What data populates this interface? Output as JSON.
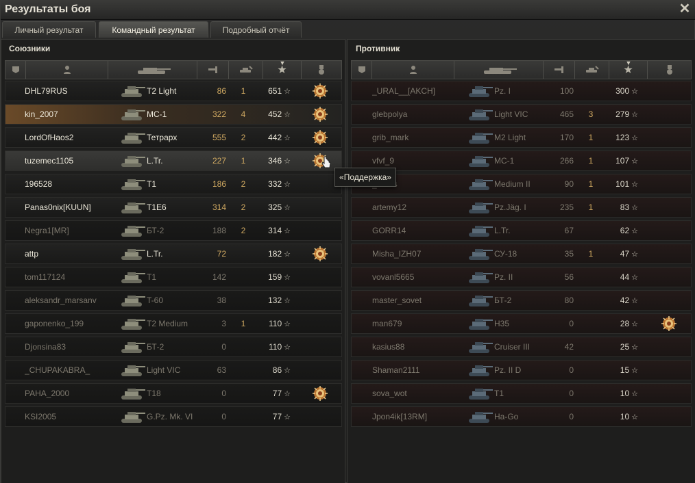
{
  "window": {
    "title": "Результаты боя"
  },
  "tabs": [
    {
      "label": "Личный результат",
      "active": false
    },
    {
      "label": "Командный результат",
      "active": true
    },
    {
      "label": "Подробный отчёт",
      "active": false
    }
  ],
  "allies": {
    "title": "Союзники",
    "columns": [
      "squad-icon",
      "player-icon",
      "tank-icon",
      "damage-icon",
      "kills-icon",
      "xp-star-icon",
      "medal-icon"
    ],
    "rows": [
      {
        "name": "DHL79RUS",
        "tank": "T2 Light",
        "damage": "86",
        "kills": "1",
        "xp": "651",
        "medal": true,
        "state": "alive"
      },
      {
        "name": "kin_2007",
        "tank": "MC-1",
        "damage": "322",
        "kills": "4",
        "xp": "452",
        "medal": true,
        "state": "player"
      },
      {
        "name": "LordOfHaos2",
        "tank": "Тетрарх",
        "damage": "555",
        "kills": "2",
        "xp": "442",
        "medal": true,
        "state": "alive"
      },
      {
        "name": "tuzemec1105",
        "tank": "L.Tr.",
        "damage": "227",
        "kills": "1",
        "xp": "346",
        "medal": true,
        "state": "hover"
      },
      {
        "name": "196528",
        "tank": "T1",
        "damage": "186",
        "kills": "2",
        "xp": "332",
        "medal": false,
        "state": "alive"
      },
      {
        "name": "Panas0nix[KUUN]",
        "tank": "T1E6",
        "damage": "314",
        "kills": "2",
        "xp": "325",
        "medal": false,
        "state": "alive"
      },
      {
        "name": "Negra1[MR]",
        "tank": "БТ-2",
        "damage": "188",
        "kills": "2",
        "xp": "314",
        "medal": false,
        "state": "dead"
      },
      {
        "name": "attp",
        "tank": "L.Tr.",
        "damage": "72",
        "kills": "",
        "xp": "182",
        "medal": true,
        "state": "alive"
      },
      {
        "name": "tom117124",
        "tank": "T1",
        "damage": "142",
        "kills": "",
        "xp": "159",
        "medal": false,
        "state": "dead"
      },
      {
        "name": "aleksandr_marsanv",
        "tank": "T-60",
        "damage": "38",
        "kills": "",
        "xp": "132",
        "medal": false,
        "state": "dead"
      },
      {
        "name": "gaponenko_199",
        "tank": "T2 Medium",
        "damage": "3",
        "kills": "1",
        "xp": "110",
        "medal": false,
        "state": "dead"
      },
      {
        "name": "Djonsina83",
        "tank": "БТ-2",
        "damage": "0",
        "kills": "",
        "xp": "110",
        "medal": false,
        "state": "dead"
      },
      {
        "name": "_CHUPAKABRA_",
        "tank": "Light VIC",
        "damage": "63",
        "kills": "",
        "xp": "86",
        "medal": false,
        "state": "dead"
      },
      {
        "name": "PAHA_2000",
        "tank": "T18",
        "damage": "0",
        "kills": "",
        "xp": "77",
        "medal": true,
        "state": "dead"
      },
      {
        "name": "KSI2005",
        "tank": "G.Pz. Mk. VI",
        "damage": "0",
        "kills": "",
        "xp": "77",
        "medal": false,
        "state": "dead"
      }
    ]
  },
  "enemies": {
    "title": "Противник",
    "rows": [
      {
        "name": "_URAL__[AKCH]",
        "tank": "Pz. I",
        "damage": "100",
        "kills": "",
        "xp": "300",
        "medal": false
      },
      {
        "name": "glebpolya",
        "tank": "Light VIC",
        "damage": "465",
        "kills": "3",
        "xp": "279",
        "medal": false
      },
      {
        "name": "grib_mark",
        "tank": "M2 Light",
        "damage": "170",
        "kills": "1",
        "xp": "123",
        "medal": false
      },
      {
        "name": "vfvf_9",
        "tank": "MC-1",
        "damage": "266",
        "kills": "1",
        "xp": "107",
        "medal": false
      },
      {
        "name": "_76rus",
        "tank": "Medium II",
        "damage": "90",
        "kills": "1",
        "xp": "101",
        "medal": false
      },
      {
        "name": "artemy12",
        "tank": "Pz.Jäg. I",
        "damage": "235",
        "kills": "1",
        "xp": "83",
        "medal": false
      },
      {
        "name": "GORR14",
        "tank": "L.Tr.",
        "damage": "67",
        "kills": "",
        "xp": "62",
        "medal": false
      },
      {
        "name": "Misha_IZH07",
        "tank": "СУ-18",
        "damage": "35",
        "kills": "1",
        "xp": "47",
        "medal": false
      },
      {
        "name": "vovanl5665",
        "tank": "Pz. II",
        "damage": "56",
        "kills": "",
        "xp": "44",
        "medal": false
      },
      {
        "name": "master_sovet",
        "tank": "БТ-2",
        "damage": "80",
        "kills": "",
        "xp": "42",
        "medal": false
      },
      {
        "name": "man679",
        "tank": "H35",
        "damage": "0",
        "kills": "",
        "xp": "28",
        "medal": true
      },
      {
        "name": "kasius88",
        "tank": "Cruiser III",
        "damage": "42",
        "kills": "",
        "xp": "25",
        "medal": false
      },
      {
        "name": "Shaman2111",
        "tank": "Pz. II D",
        "damage": "0",
        "kills": "",
        "xp": "15",
        "medal": false
      },
      {
        "name": "sova_wot",
        "tank": "T1",
        "damage": "0",
        "kills": "",
        "xp": "10",
        "medal": false
      },
      {
        "name": "Jpon4ik[13RM]",
        "tank": "Ha-Go",
        "damage": "0",
        "kills": "",
        "xp": "10",
        "medal": false
      }
    ]
  },
  "tooltip": {
    "text": "«Поддержка»"
  },
  "colors": {
    "accent_gold": "#d1aa62",
    "enemy_row": "#2b1d1b",
    "player_highlight": "#6a4a28"
  }
}
